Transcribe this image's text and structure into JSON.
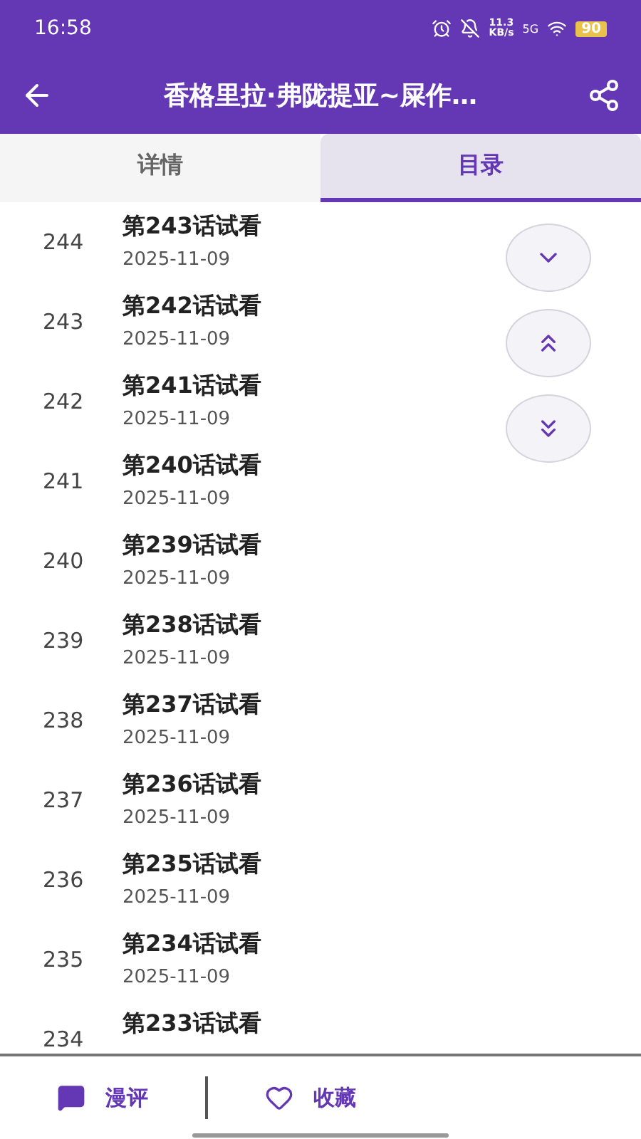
{
  "status_bar": {
    "time": "16:58",
    "speed": "11.3",
    "speed_unit": "KB/s",
    "network": "5G",
    "battery": "90"
  },
  "header": {
    "title": "香格里拉·弗陇提亚~屎作…"
  },
  "tabs": [
    {
      "label": "详情",
      "selected": false
    },
    {
      "label": "目录",
      "selected": true
    }
  ],
  "chapters": [
    {
      "number": "244",
      "title": "第243话试看",
      "date": "2025-11-09"
    },
    {
      "number": "243",
      "title": "第242话试看",
      "date": "2025-11-09"
    },
    {
      "number": "242",
      "title": "第241话试看",
      "date": "2025-11-09"
    },
    {
      "number": "241",
      "title": "第240话试看",
      "date": "2025-11-09"
    },
    {
      "number": "240",
      "title": "第239话试看",
      "date": "2025-11-09"
    },
    {
      "number": "239",
      "title": "第238话试看",
      "date": "2025-11-09"
    },
    {
      "number": "238",
      "title": "第237话试看",
      "date": "2025-11-09"
    },
    {
      "number": "237",
      "title": "第236话试看",
      "date": "2025-11-09"
    },
    {
      "number": "236",
      "title": "第235话试看",
      "date": "2025-11-09"
    },
    {
      "number": "235",
      "title": "第234话试看",
      "date": "2025-11-09"
    },
    {
      "number": "234",
      "title": "第233话试看"
    }
  ],
  "float_buttons": [
    {
      "kind": "down"
    },
    {
      "kind": "top"
    },
    {
      "kind": "bottom"
    }
  ],
  "bottom_bar": [
    {
      "kind": "comment",
      "label": "漫评"
    },
    {
      "kind": "favorite",
      "label": "收藏"
    }
  ]
}
